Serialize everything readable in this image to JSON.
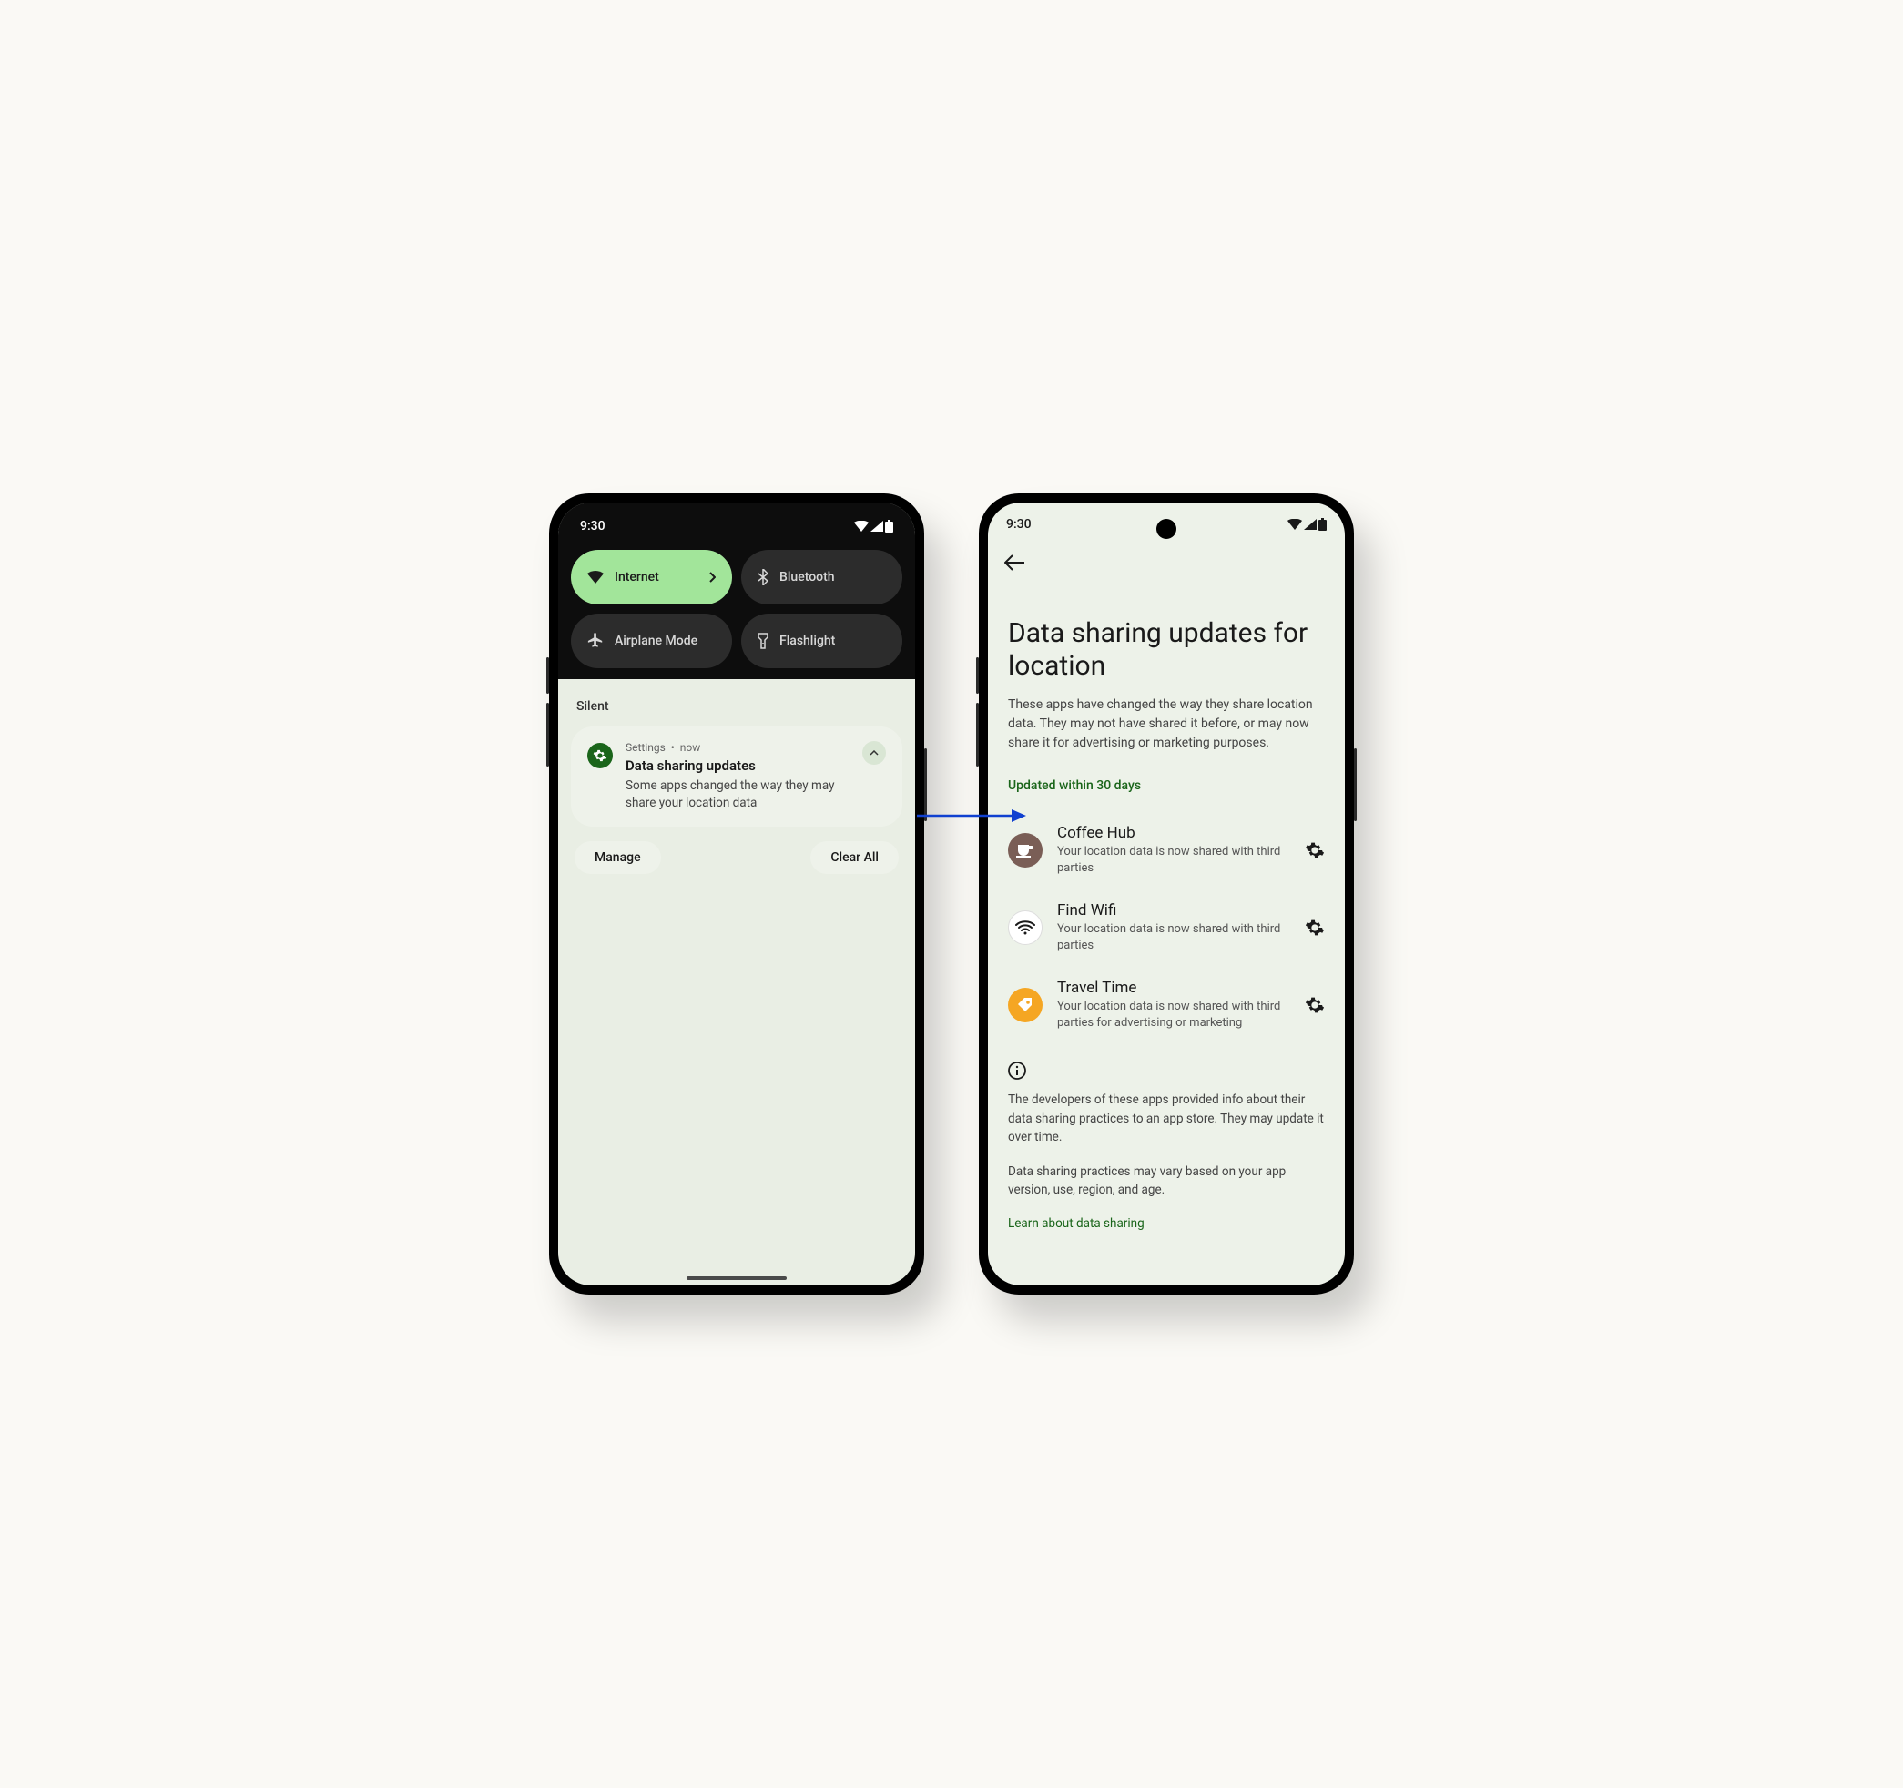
{
  "status_time": "9:30",
  "left": {
    "qs": {
      "internet": "Internet",
      "bluetooth": "Bluetooth",
      "airplane": "Airplane Mode",
      "flashlight": "Flashlight"
    },
    "section_silent": "Silent",
    "notif": {
      "app": "Settings",
      "sep": "•",
      "time": "now",
      "title": "Data sharing updates",
      "body": "Some apps changed the way they may share your location data"
    },
    "manage": "Manage",
    "clear_all": "Clear All"
  },
  "right": {
    "title": "Data sharing updates for location",
    "desc": "These apps have changed the way they share location data. They may not have shared it before, or may now share it for advertising or marketing purposes.",
    "updated_label": "Updated within 30 days",
    "apps": [
      {
        "name": "Coffee Hub",
        "sub": "Your location data is now shared with third parties"
      },
      {
        "name": "Find Wifi",
        "sub": "Your location data is now shared with third parties"
      },
      {
        "name": "Travel Time",
        "sub": "Your location data is now shared with third parties for advertising or marketing"
      }
    ],
    "info1": "The developers of these apps provided info about their data sharing practices to an app store. They may update it over time.",
    "info2": "Data sharing practices may vary based on your app version, use, region, and age.",
    "learn": "Learn about data sharing"
  }
}
